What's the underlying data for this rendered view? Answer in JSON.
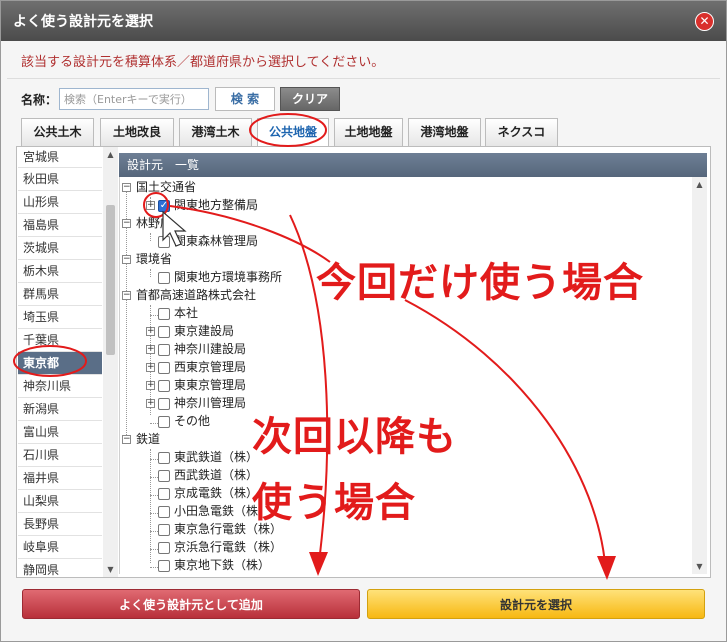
{
  "dialog": {
    "title": "よく使う設計元を選択",
    "close_glyph": "✕"
  },
  "instruction": "該当する設計元を積算体系／都道府県から選択してください。",
  "search": {
    "label": "名称：",
    "placeholder": "検索（Enterキーで実行）",
    "value": "",
    "search_label": "検 索",
    "clear_label": "クリア"
  },
  "tabs": [
    {
      "label": "公共土木",
      "active": false
    },
    {
      "label": "土地改良",
      "active": false
    },
    {
      "label": "港湾土木",
      "active": false
    },
    {
      "label": "公共地盤",
      "active": true
    },
    {
      "label": "土地地盤",
      "active": false
    },
    {
      "label": "港湾地盤",
      "active": false
    },
    {
      "label": "ネクスコ",
      "active": false
    }
  ],
  "prefectures": [
    "宮城県",
    "秋田県",
    "山形県",
    "福島県",
    "茨城県",
    "栃木県",
    "群馬県",
    "埼玉県",
    "千葉県",
    "東京都",
    "神奈川県",
    "新潟県",
    "富山県",
    "石川県",
    "福井県",
    "山梨県",
    "長野県",
    "岐阜県",
    "静岡県"
  ],
  "selected_prefecture": "東京都",
  "tree": {
    "header": "設計元　一覧",
    "groups": [
      {
        "label": "国土交通省",
        "children": [
          {
            "label": "関東地方整備局",
            "expandable": true,
            "checked": true
          }
        ]
      },
      {
        "label": "林野庁",
        "children": [
          {
            "label": "関東森林管理局",
            "expandable": false,
            "checked": false
          }
        ]
      },
      {
        "label": "環境省",
        "children": [
          {
            "label": "関東地方環境事務所",
            "expandable": false,
            "checked": false
          }
        ]
      },
      {
        "label": "首都高速道路株式会社",
        "children": [
          {
            "label": "本社",
            "expandable": false,
            "checked": false
          },
          {
            "label": "東京建設局",
            "expandable": true,
            "checked": false
          },
          {
            "label": "神奈川建設局",
            "expandable": true,
            "checked": false
          },
          {
            "label": "西東京管理局",
            "expandable": true,
            "checked": false
          },
          {
            "label": "東東京管理局",
            "expandable": true,
            "checked": false
          },
          {
            "label": "神奈川管理局",
            "expandable": true,
            "checked": false
          },
          {
            "label": "その他",
            "expandable": false,
            "checked": false
          }
        ]
      },
      {
        "label": "鉄道",
        "children": [
          {
            "label": "東武鉄道（株）",
            "expandable": false,
            "checked": false
          },
          {
            "label": "西武鉄道（株）",
            "expandable": false,
            "checked": false
          },
          {
            "label": "京成電鉄（株）",
            "expandable": false,
            "checked": false
          },
          {
            "label": "小田急電鉄（株）",
            "expandable": false,
            "checked": false
          },
          {
            "label": "東京急行電鉄（株）",
            "expandable": false,
            "checked": false
          },
          {
            "label": "京浜急行電鉄（株）",
            "expandable": false,
            "checked": false
          },
          {
            "label": "東京地下鉄（株）",
            "expandable": false,
            "checked": false
          }
        ]
      }
    ]
  },
  "buttons": {
    "add_label": "よく使う設計元として追加",
    "select_label": "設計元を選択"
  },
  "annotations": {
    "this_time_only": "今回だけ使う場合",
    "next_time_line1": "次回以降も",
    "next_time_line2": "使う場合",
    "color": "#e21b1b"
  }
}
